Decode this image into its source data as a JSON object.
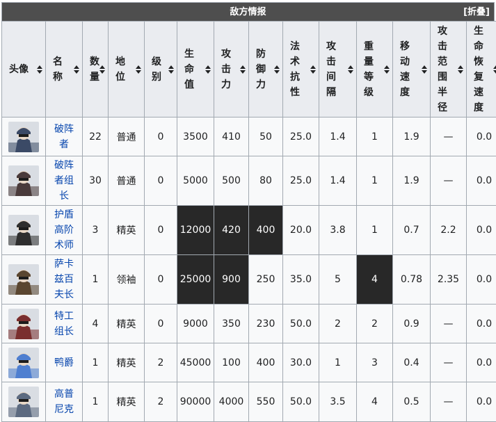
{
  "panel": {
    "title": "敌方情报",
    "collapse_label": "[折叠]"
  },
  "headers": [
    {
      "key": "avatar",
      "label": "头像"
    },
    {
      "key": "name",
      "label": "名称"
    },
    {
      "key": "count",
      "label": "数量"
    },
    {
      "key": "status",
      "label": "地位"
    },
    {
      "key": "level",
      "label": "级别"
    },
    {
      "key": "hp",
      "label": "生命值"
    },
    {
      "key": "atk",
      "label": "攻击力"
    },
    {
      "key": "def",
      "label": "防御力"
    },
    {
      "key": "res",
      "label": "法术抗性"
    },
    {
      "key": "interval",
      "label": "攻击间隔"
    },
    {
      "key": "weight",
      "label": "重量等级"
    },
    {
      "key": "speed",
      "label": "移动速度"
    },
    {
      "key": "range",
      "label": "攻击范围半径"
    },
    {
      "key": "regen",
      "label": "生命恢复速度"
    }
  ],
  "rows": [
    {
      "avatar": "breaker-avatar",
      "avatar_color": "#3b4a66",
      "name": "破阵者",
      "count": "22",
      "status": "普通",
      "level": "0",
      "hp": "3500",
      "atk": "410",
      "def": "50",
      "res": "25.0",
      "interval": "1.4",
      "weight": "1",
      "speed": "1.9",
      "range": "—",
      "regen": "0.0",
      "dark": []
    },
    {
      "avatar": "breaker-leader-avatar",
      "avatar_color": "#4a3b3b",
      "name": "破阵者组长",
      "count": "30",
      "status": "普通",
      "level": "0",
      "hp": "5000",
      "atk": "500",
      "def": "80",
      "res": "25.0",
      "interval": "1.4",
      "weight": "1",
      "speed": "1.9",
      "range": "—",
      "regen": "0.0",
      "dark": []
    },
    {
      "avatar": "shield-caster-avatar",
      "avatar_color": "#2e2e2e",
      "name": "护盾高阶术师",
      "count": "3",
      "status": "精英",
      "level": "0",
      "hp": "12000",
      "atk": "420",
      "def": "400",
      "res": "20.0",
      "interval": "3.8",
      "weight": "1",
      "speed": "0.7",
      "range": "2.2",
      "regen": "0.0",
      "dark": [
        "hp",
        "atk",
        "def"
      ]
    },
    {
      "avatar": "sarkaz-centurion-avatar",
      "avatar_color": "#5a4630",
      "name": "萨卡兹百夫长",
      "count": "1",
      "status": "领袖",
      "level": "0",
      "hp": "25000",
      "atk": "900",
      "def": "250",
      "res": "35.0",
      "interval": "5",
      "weight": "4",
      "speed": "0.78",
      "range": "2.35",
      "regen": "0.0",
      "dark": [
        "hp",
        "atk",
        "weight"
      ]
    },
    {
      "avatar": "agent-leader-avatar",
      "avatar_color": "#7a2e2e",
      "name": "特工组长",
      "count": "4",
      "status": "精英",
      "level": "0",
      "hp": "9000",
      "atk": "350",
      "def": "230",
      "res": "50.0",
      "interval": "2",
      "weight": "2",
      "speed": "0.9",
      "range": "—",
      "regen": "0.0",
      "dark": []
    },
    {
      "avatar": "duke-duck-avatar",
      "avatar_color": "#4f7fd0",
      "name": "鸭爵",
      "count": "1",
      "status": "精英",
      "level": "2",
      "hp": "45000",
      "atk": "100",
      "def": "400",
      "res": "30.0",
      "interval": "1",
      "weight": "3",
      "speed": "0.4",
      "range": "—",
      "regen": "0.0",
      "dark": []
    },
    {
      "avatar": "gopnik-avatar",
      "avatar_color": "#5c6a80",
      "name": "高普尼克",
      "count": "1",
      "status": "精英",
      "level": "2",
      "hp": "90000",
      "atk": "4000",
      "def": "550",
      "res": "50.0",
      "interval": "3.5",
      "weight": "4",
      "speed": "0.5",
      "range": "—",
      "regen": "0.0",
      "dark": []
    }
  ]
}
